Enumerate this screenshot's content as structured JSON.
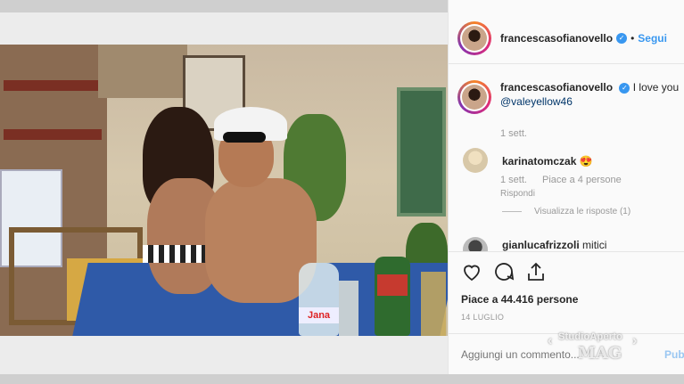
{
  "post": {
    "username": "francescasofianovello",
    "follow_label": "Segui",
    "separator": "•"
  },
  "caption": {
    "username": "francescasofianovello",
    "text": "I love you",
    "mention": "@valeyellow46",
    "time": "1 sett."
  },
  "comments": [
    {
      "username": "karinatomczak",
      "text": "😍"
    },
    {
      "username": "gianlucafrizzoli",
      "text": "mitici",
      "time": "1 sett.",
      "likes": "Piace a 4 persone",
      "reply": "Rispondi",
      "view_replies": "Visualizza le risposte (1)"
    }
  ],
  "actions": {
    "like_icon": "heart-icon",
    "comment_icon": "comment-icon",
    "share_icon": "share-icon",
    "likes_text": "Piace a 44.416 persone",
    "date": "14 LUGLIO"
  },
  "add_comment": {
    "placeholder": "Aggiungi un commento...",
    "publish_label": "Pubblica"
  },
  "watermark": {
    "line1": "StudioAperto",
    "line2": "MAG"
  },
  "photo": {
    "bottle_brand": "Jana"
  },
  "colors": {
    "link_blue": "#3897f0",
    "mention_blue": "#003569",
    "text": "#262626",
    "muted": "#999999"
  }
}
